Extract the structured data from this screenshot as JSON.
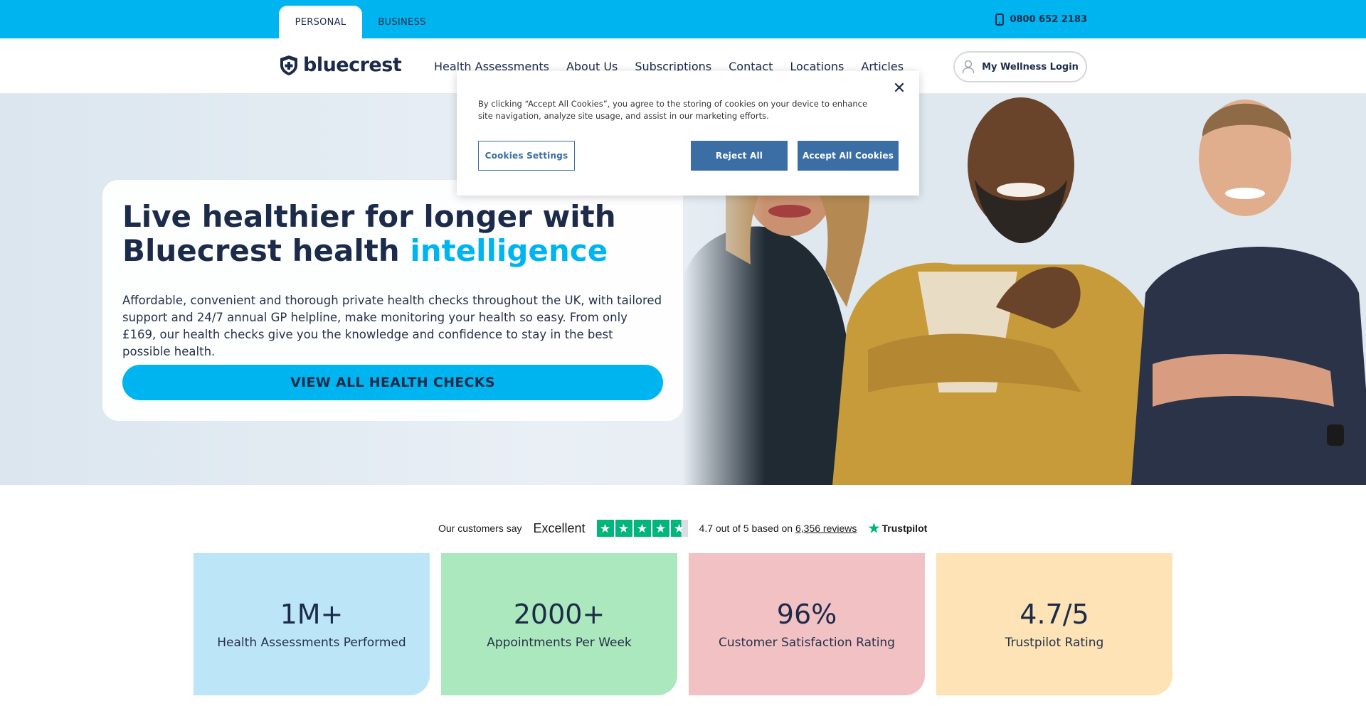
{
  "topbar": {
    "tabs": [
      {
        "label": "PERSONAL",
        "active": true
      },
      {
        "label": "BUSINESS",
        "active": false
      }
    ],
    "phone": "0800 652 2183"
  },
  "header": {
    "logo_text": "bluecrest",
    "nav": [
      "Health Assessments",
      "About Us",
      "Subscriptions",
      "Contact",
      "Locations",
      "Articles"
    ],
    "login_label": "My Wellness Login"
  },
  "hero": {
    "title_part1": "Live healthier for longer with Bluecrest health ",
    "title_accent": "intelligence",
    "description": "Affordable, convenient and thorough private health checks throughout the UK, with tailored support and 24/7 annual GP helpline, make monitoring your health so easy. From only £169, our health checks give you the knowledge and confidence to stay in the best possible health.",
    "cta": "VIEW ALL HEALTH CHECKS"
  },
  "cookie": {
    "text": "By clicking “Accept All Cookies”, you agree to the storing of cookies on your device to enhance site navigation, analyze site usage, and assist in our marketing efforts.",
    "settings_label": "Cookies Settings",
    "reject_label": "Reject All",
    "accept_label": "Accept All Cookies"
  },
  "trustpilot": {
    "customers_say": "Our customers say",
    "rating_word": "Excellent",
    "stars": 4.5,
    "score_text": "4.7 out of 5 based on",
    "reviews_link": "6,356 reviews",
    "brand": "Trustpilot"
  },
  "stats": [
    {
      "value": "1M+",
      "label": "Health Assessments Performed",
      "color": "#bde5f8"
    },
    {
      "value": "2000+",
      "label": "Appointments Per Week",
      "color": "#ace8bd"
    },
    {
      "value": "96%",
      "label": "Customer Satisfaction Rating",
      "color": "#f2c1c3"
    },
    {
      "value": "4.7/5",
      "label": "Trustpilot Rating",
      "color": "#fde3b5"
    }
  ],
  "colors": {
    "brand_blue": "#00b5ef",
    "navy": "#1c2b4a",
    "cookie_button": "#3a6ea5",
    "trustpilot_green": "#00b67a"
  },
  "icons": {
    "phone": "phone-icon",
    "user": "user-icon",
    "close": "close-icon",
    "logo": "shield-plus-icon",
    "trustpilot": "star-icon"
  }
}
